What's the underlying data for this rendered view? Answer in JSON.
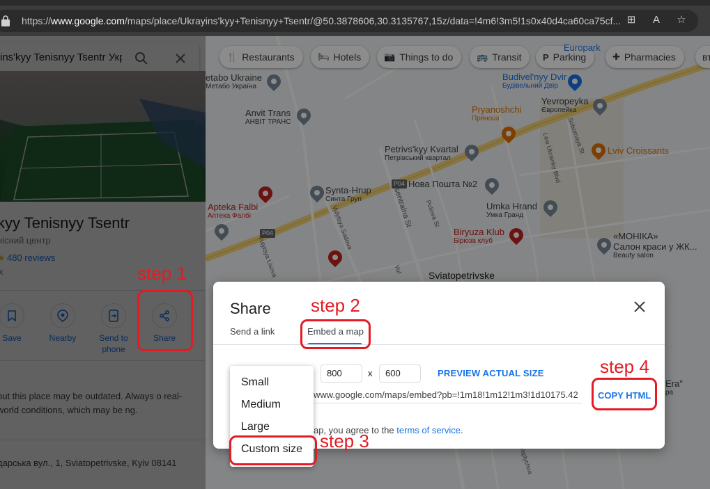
{
  "browser": {
    "url_prefix": "https://",
    "url_host": "www.google.com",
    "url_rest": "/maps/place/Ukrayins'kyy+Tenisnyy+Tsentr/@50.3878606,30.3135767,15z/data=!4m6!3m5!1s0x40d4ca60ca75cf..."
  },
  "place_panel": {
    "search_text": "ins'kyy Tenisnyy Tsentr Укр",
    "title": "kyy Tenisnyy Tsentr",
    "subtitle": "нісний центр",
    "reviews": "480 reviews",
    "rating_fragment": "x",
    "actions": [
      {
        "label": "Save"
      },
      {
        "label": "Nearby"
      },
      {
        "label": "Send to phone"
      },
      {
        "label": "Share"
      }
    ],
    "description": "out this place may be outdated. Always o real-world conditions, which may be ng.",
    "address": "дарська вул., 1, Sviatopetrivske, Kyiv 08141"
  },
  "map": {
    "chips": [
      "Restaurants",
      "Hotels",
      "Things to do",
      "Transit",
      "Parking",
      "Pharmacies",
      "вт"
    ],
    "pois": [
      {
        "name": "Europark",
        "sub": ""
      },
      {
        "name": "etabo Ukraine",
        "sub": "Метабо Україна"
      },
      {
        "name": "Budivel'nyy Dvir",
        "sub": "Будівельний Двір"
      },
      {
        "name": "Yevropeyka",
        "sub": "Європейка"
      },
      {
        "name": "Anvit Trans",
        "sub": "АНВІТ ТРАНС"
      },
      {
        "name": "Pryanoshchi",
        "sub": "Пряноші"
      },
      {
        "name": "Lviv Croissants",
        "sub": ""
      },
      {
        "name": "Petrivs'kyy Kvartal",
        "sub": "Петрівський квартал"
      },
      {
        "name": "Synta-Hrup",
        "sub": "Синта Груп"
      },
      {
        "name": "Нова Пошта №2",
        "sub": ""
      },
      {
        "name": "Apteka Falbi",
        "sub": "Аптека Фалбі"
      },
      {
        "name": "Umka Hrand",
        "sub": "Умка Гранд"
      },
      {
        "name": "Biryuza Klub",
        "sub": "Бірюза клуб"
      },
      {
        "name": "«МОНІКА»",
        "sub": "Салон краси у ЖК..."
      },
      {
        "name": "Beauty salon",
        "sub": ""
      },
      {
        "name": "Sviatopetrivske",
        "sub": ""
      },
      {
        "name": "Era\"",
        "sub": "ра"
      }
    ],
    "streets": [
      "Tsentralna St",
      "Poliova St",
      "Sobornaya St",
      "Lesi Ukrainky Blvd",
      "Vulytsya Sadova",
      "Vulytsya Lisova",
      "Vul",
      "Teplychna",
      "P04"
    ]
  },
  "share_dialog": {
    "title": "Share",
    "tabs": [
      "Send a link",
      "Embed a map"
    ],
    "width": "800",
    "height": "600",
    "x_sep": "x",
    "preview_label": "PREVIEW ACTUAL SIZE",
    "embed_code": "www.google.com/maps/embed?pb=!1m18!1m12!1m3!1d10175.42",
    "copy_label": "COPY HTML",
    "tos_prefix": "ap, you agree to the",
    "tos_link": "terms of service",
    "tos_suffix": ".",
    "size_options": [
      "Small",
      "Medium",
      "Large",
      "Custom size"
    ]
  },
  "annotations": {
    "step1": "step 1",
    "step2": "step 2",
    "step3": "step 3",
    "step4": "step 4"
  },
  "colors": {
    "annotation_red": "#e31b23",
    "link_blue": "#1a73e8",
    "road_yellow": "#f5d57a"
  }
}
